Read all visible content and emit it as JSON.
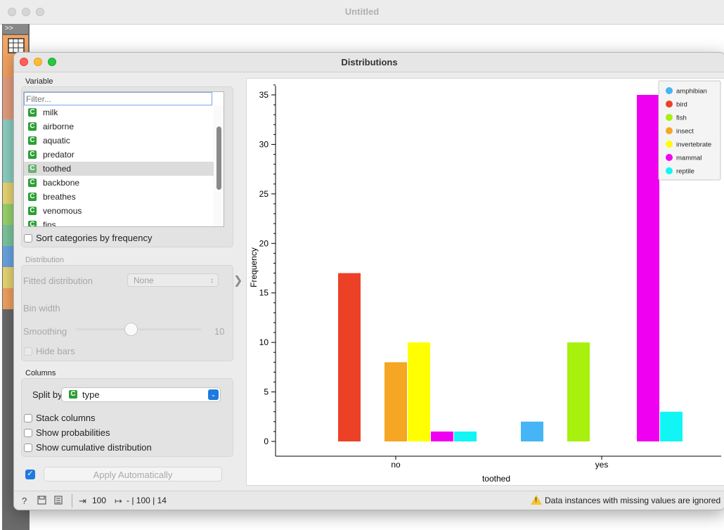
{
  "background_window": {
    "title": "Untitled"
  },
  "window": {
    "title": "Distributions"
  },
  "variable": {
    "label": "Variable",
    "filter_placeholder": "Filter...",
    "items": [
      {
        "badge": "C",
        "label": "milk"
      },
      {
        "badge": "C",
        "label": "airborne"
      },
      {
        "badge": "C",
        "label": "aquatic"
      },
      {
        "badge": "C",
        "label": "predator"
      },
      {
        "badge": "C",
        "label": "toothed"
      },
      {
        "badge": "C",
        "label": "backbone"
      },
      {
        "badge": "C",
        "label": "breathes"
      },
      {
        "badge": "C",
        "label": "venomous"
      },
      {
        "badge": "C",
        "label": "fins"
      }
    ],
    "selected": "toothed",
    "sort_label": "Sort categories by frequency"
  },
  "distribution": {
    "label": "Distribution",
    "fitted_label": "Fitted distribution",
    "fitted_value": "None",
    "bin_width_label": "Bin width",
    "smoothing_label": "Smoothing",
    "smoothing_value": "10",
    "smoothing_level": 0.44,
    "hide_bars_label": "Hide bars"
  },
  "columns": {
    "label": "Columns",
    "split_by_label": "Split by",
    "split_badge": "C",
    "split_value": "type",
    "stack_label": "Stack columns",
    "probabilities_label": "Show probabilities",
    "cumulative_label": "Show cumulative distribution"
  },
  "apply": {
    "label": "Apply Automatically",
    "checked": true
  },
  "status": {
    "input_count": "100",
    "output_text": "- | 100 | 14",
    "warning": "Data instances with missing values are ignored"
  },
  "chart_data": {
    "type": "bar",
    "categories": [
      "no",
      "yes"
    ],
    "xlabel": "toothed",
    "ylabel": "Frequency",
    "ylim": [
      0,
      36
    ],
    "yticks": [
      0,
      5,
      10,
      15,
      20,
      25,
      30,
      35
    ],
    "legend_position": "top-right",
    "series": [
      {
        "name": "amphibian",
        "color": "#45b5f5",
        "values": [
          0,
          2
        ]
      },
      {
        "name": "bird",
        "color": "#ec4127",
        "values": [
          17,
          0
        ]
      },
      {
        "name": "fish",
        "color": "#a8f00d",
        "values": [
          0,
          10
        ]
      },
      {
        "name": "insect",
        "color": "#f5a623",
        "values": [
          8,
          0
        ]
      },
      {
        "name": "invertebrate",
        "color": "#ffff00",
        "values": [
          10,
          0
        ]
      },
      {
        "name": "mammal",
        "color": "#f000f0",
        "values": [
          1,
          35
        ]
      },
      {
        "name": "reptile",
        "color": "#12f5f5",
        "values": [
          1,
          3
        ]
      }
    ]
  }
}
